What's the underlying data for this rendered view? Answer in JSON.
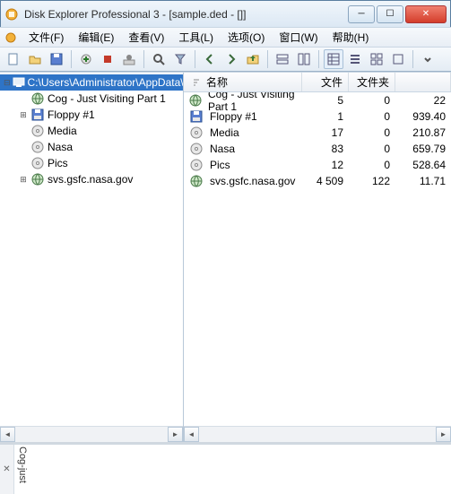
{
  "window": {
    "title": "Disk Explorer Professional 3 - [sample.ded - []]"
  },
  "menu": {
    "file": "文件(F)",
    "edit": "编辑(E)",
    "view": "查看(V)",
    "tools": "工具(L)",
    "options": "选项(O)",
    "window": "窗口(W)",
    "help": "帮助(H)"
  },
  "columns": {
    "name": "名称",
    "files": "文件",
    "folders": "文件夹",
    "extra": ""
  },
  "tree": {
    "root": "C:\\Users\\Administrator\\AppData\\",
    "children": [
      {
        "label": "Cog - Just Visiting Part 1",
        "icon": "globe"
      },
      {
        "label": "Floppy #1",
        "icon": "floppy",
        "expandable": true
      },
      {
        "label": "Media",
        "icon": "disc"
      },
      {
        "label": "Nasa",
        "icon": "disc"
      },
      {
        "label": "Pics",
        "icon": "disc"
      },
      {
        "label": "svs.gsfc.nasa.gov",
        "icon": "globe",
        "expandable": true
      }
    ]
  },
  "list": [
    {
      "name": "Cog - Just Visiting Part 1",
      "icon": "globe",
      "files": "5",
      "folders": "0",
      "c3": "22"
    },
    {
      "name": "Floppy #1",
      "icon": "floppy",
      "files": "1",
      "folders": "0",
      "c3": "939.40"
    },
    {
      "name": "Media",
      "icon": "disc",
      "files": "17",
      "folders": "0",
      "c3": "210.87"
    },
    {
      "name": "Nasa",
      "icon": "disc",
      "files": "83",
      "folders": "0",
      "c3": "659.79"
    },
    {
      "name": "Pics",
      "icon": "disc",
      "files": "12",
      "folders": "0",
      "c3": "528.64"
    },
    {
      "name": "svs.gsfc.nasa.gov",
      "icon": "globe",
      "files": "4 509",
      "folders": "122",
      "c3": "11.71"
    }
  ],
  "bottom": {
    "text": "Cog-just"
  }
}
